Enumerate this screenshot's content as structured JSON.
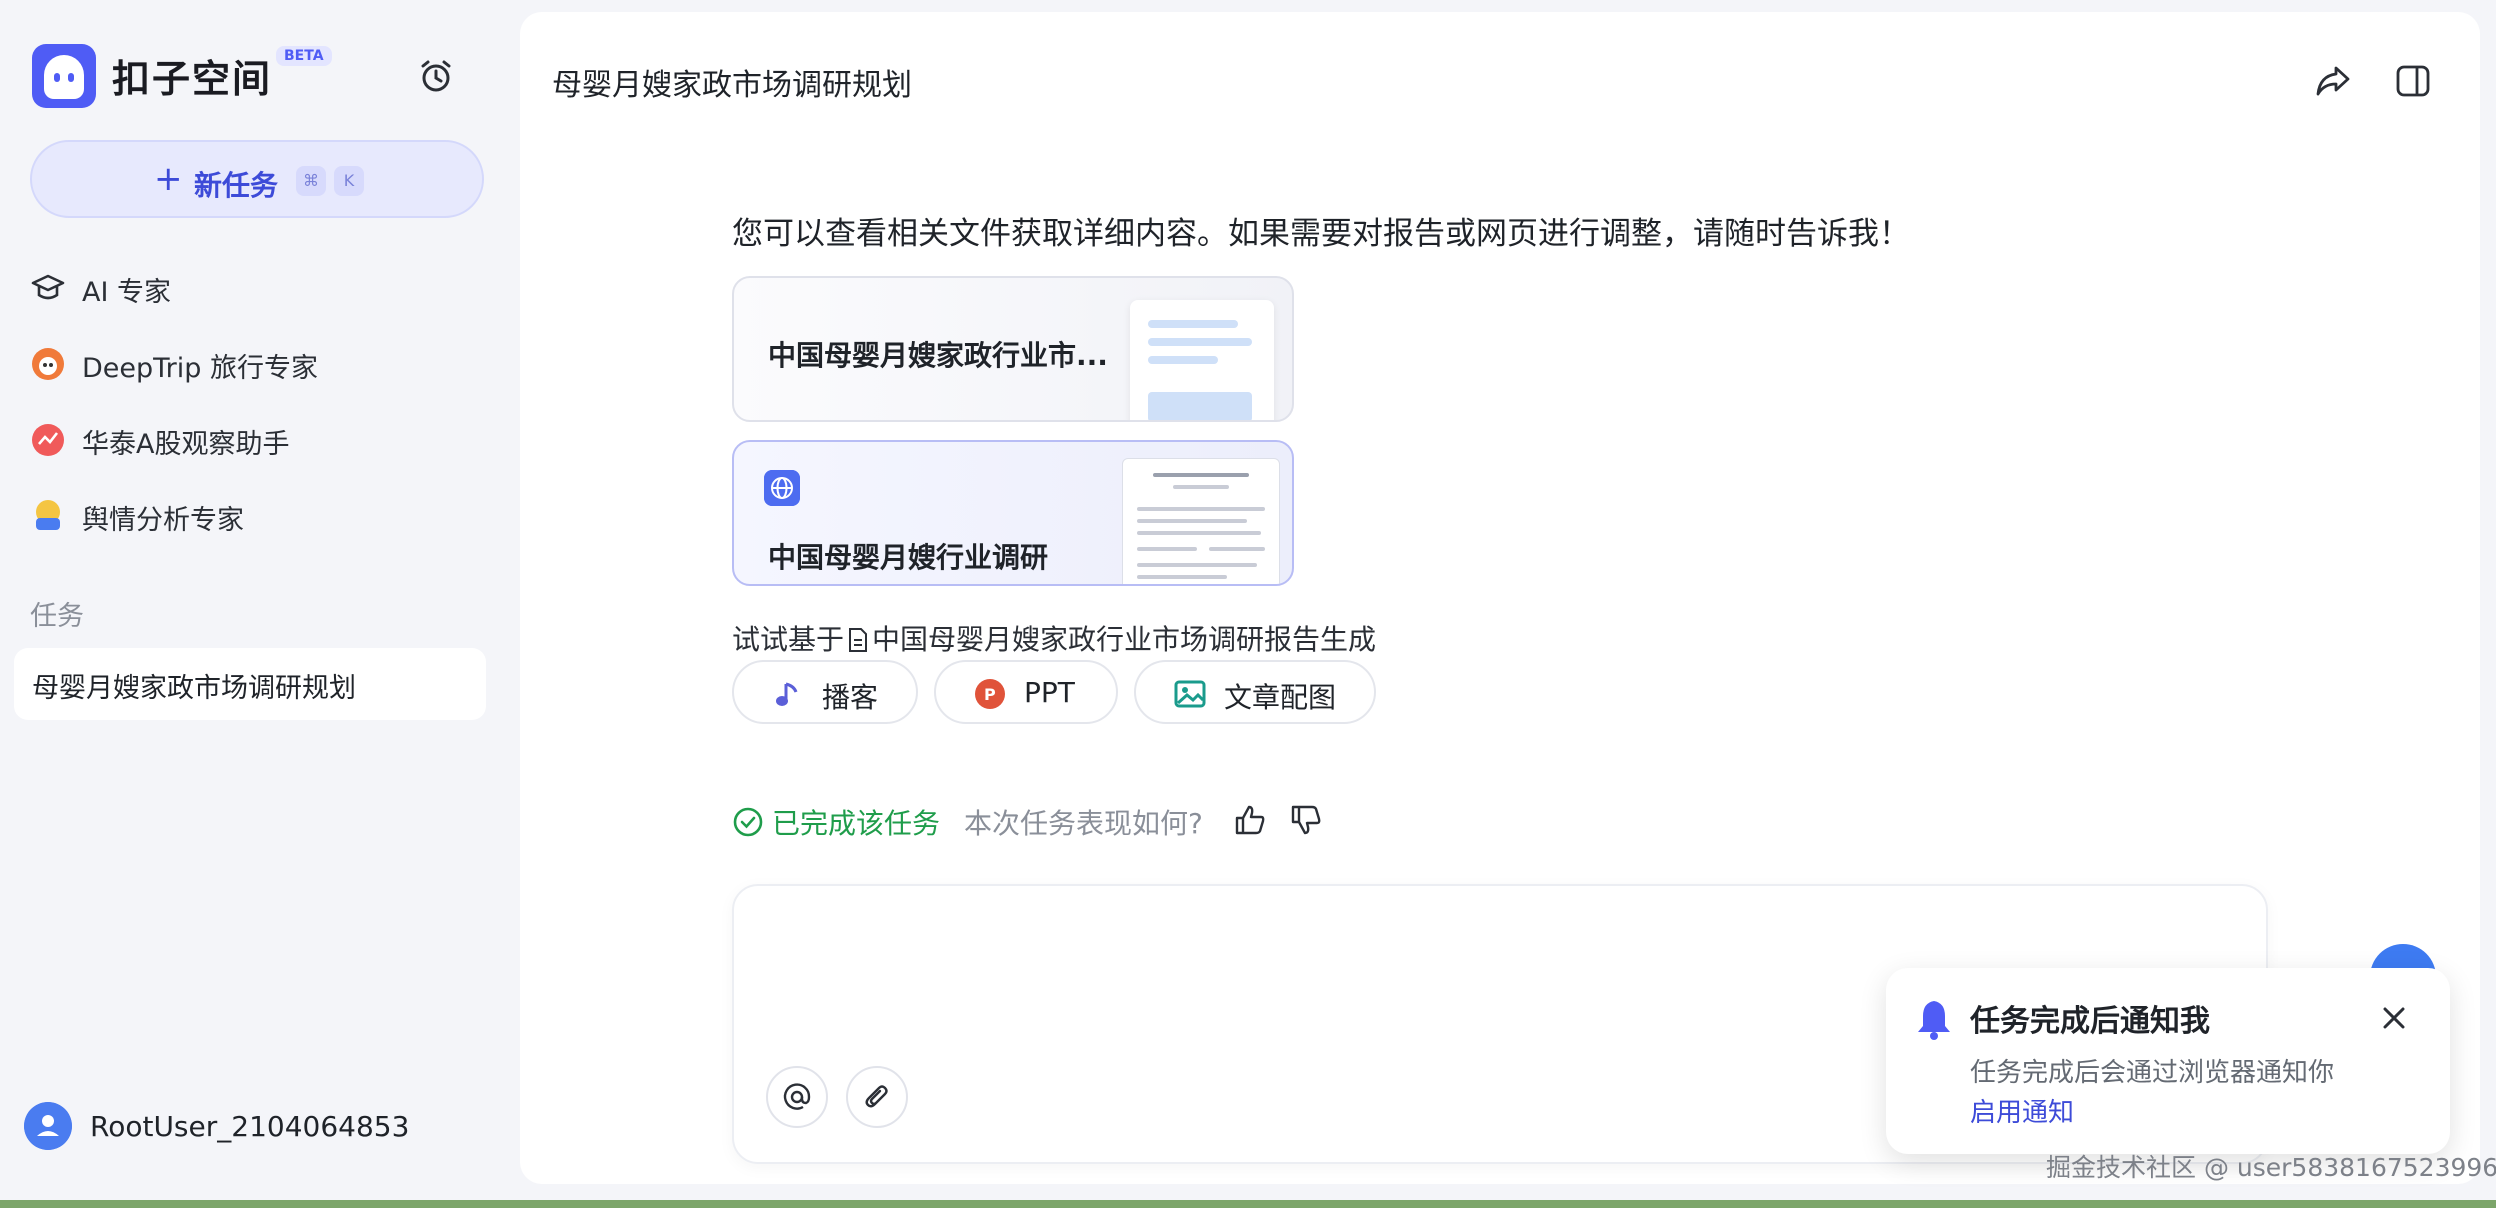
{
  "sidebar": {
    "brand": "扣子空间",
    "beta": "BETA",
    "new_task": {
      "label": "新任务",
      "keys": [
        "⌘",
        "K"
      ]
    },
    "nav": [
      {
        "label": "AI 专家",
        "icon": "graduation-cap-icon"
      },
      {
        "label": "DeepTrip 旅行专家",
        "icon": "deeptrip-icon"
      },
      {
        "label": "华泰A股观察助手",
        "icon": "stock-chart-icon"
      },
      {
        "label": "舆情分析专家",
        "icon": "sentiment-icon"
      }
    ],
    "section_title": "任务",
    "tasks": [
      {
        "label": "母婴月嫂家政市场调研规划"
      }
    ],
    "user": "RootUser_2104064853"
  },
  "main": {
    "title": "母婴月嫂家政市场调研规划",
    "message": "您可以查看相关文件获取详细内容。如果需要对报告或网页进行调整，请随时告诉我！",
    "cards": [
      {
        "title": "中国母婴月嫂家政行业市...",
        "type": "document"
      },
      {
        "title": "中国母婴月嫂行业调研",
        "type": "webpage"
      }
    ],
    "suggest_prefix": "试试基于",
    "suggest_file": "中国母婴月嫂家政行业市场调研报告生成",
    "actions": [
      {
        "label": "播客",
        "icon": "music-note-icon"
      },
      {
        "label": "PPT",
        "icon": "ppt-icon"
      },
      {
        "label": "文章配图",
        "icon": "image-icon"
      }
    ],
    "status": {
      "done": "已完成该任务",
      "feedback_prompt": "本次任务表现如何?"
    }
  },
  "notification": {
    "title": "任务完成后通知我",
    "desc": "任务完成后会通过浏览器通知你",
    "link": "启用通知"
  },
  "watermark": "掘金技术社区 @ user5838167523996",
  "colors": {
    "accent": "#4f5cf5",
    "success": "#1f9d4b",
    "link": "#3d4bd8",
    "fab": "#3e7bf2"
  }
}
